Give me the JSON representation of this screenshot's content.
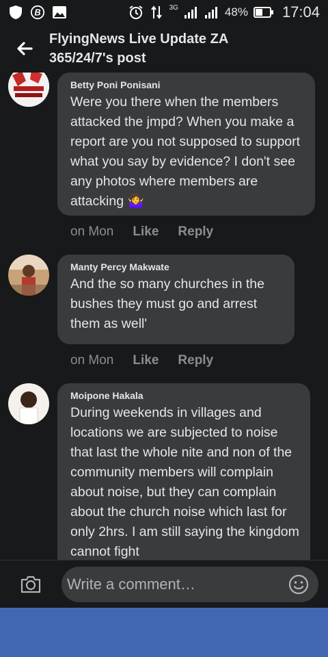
{
  "status": {
    "network_type": "3G",
    "battery_percent": "48%",
    "time": "17:04"
  },
  "header": {
    "title_line1": "FlyingNews Live Update ZA",
    "title_line2": "365/24/7's post"
  },
  "comments": [
    {
      "author": "Betty Poni Ponisani",
      "text": "Were you there when the members attacked the jmpd? When you make a report are you not supposed to support what you say by evidence? I don't see any photos where members are attacking 🤷‍♀️",
      "when": "on Mon",
      "like_label": "Like",
      "reply_label": "Reply",
      "avatar_caption": "STOP POLICE BRUTALITY"
    },
    {
      "author": "Manty Percy Makwate",
      "text": "And the so many churches in the bushes they must go and arrest them as well'",
      "when": "on Mon",
      "like_label": "Like",
      "reply_label": "Reply"
    },
    {
      "author": "Moipone Hakala",
      "text": "During weekends in villages and locations we are subjected to noise that last the whole nite and non of the community members will complain about noise, but they can complain about the church noise which last for only 2hrs. I am still saying the kingdom cannot fight"
    }
  ],
  "composer": {
    "placeholder": "Write a comment…"
  },
  "icons": [
    "shield-icon",
    "b-circle-icon",
    "image-icon",
    "alarm-icon",
    "data-arrows-icon",
    "signal-icon",
    "battery-icon",
    "back-arrow-icon",
    "camera-icon",
    "emoji-icon"
  ]
}
